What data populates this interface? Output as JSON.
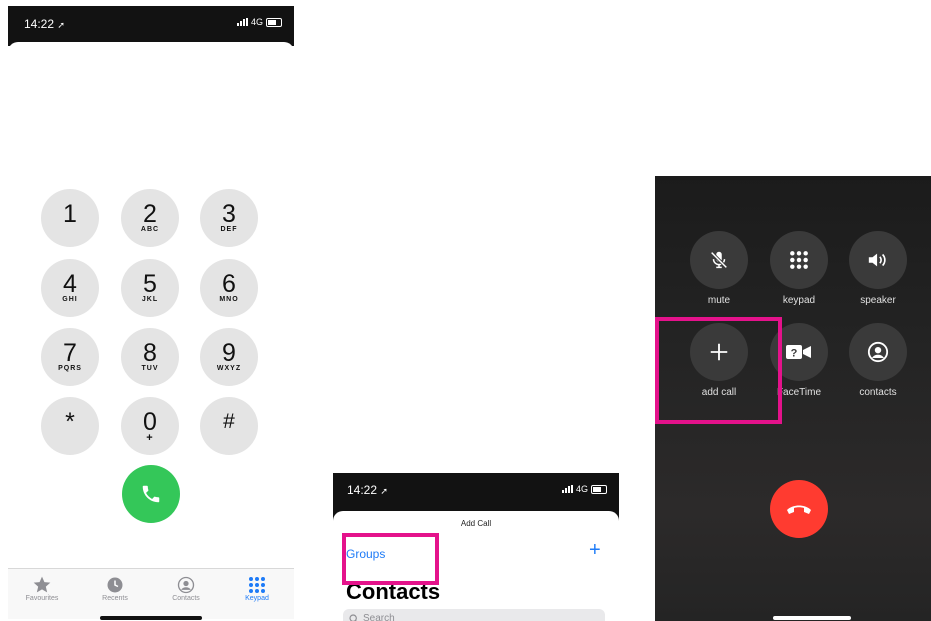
{
  "status": {
    "time": "14:22",
    "network": "4G"
  },
  "keypad": {
    "keys": [
      {
        "digit": "1",
        "letters": ""
      },
      {
        "digit": "2",
        "letters": "ABC"
      },
      {
        "digit": "3",
        "letters": "DEF"
      },
      {
        "digit": "4",
        "letters": "GHI"
      },
      {
        "digit": "5",
        "letters": "JKL"
      },
      {
        "digit": "6",
        "letters": "MNO"
      },
      {
        "digit": "7",
        "letters": "PQRS"
      },
      {
        "digit": "8",
        "letters": "TUV"
      },
      {
        "digit": "9",
        "letters": "WXYZ"
      },
      {
        "digit": "*",
        "letters": ""
      },
      {
        "digit": "0",
        "letters": "+"
      },
      {
        "digit": "#",
        "letters": ""
      }
    ],
    "call_color": "#34c759"
  },
  "tabbar": {
    "tabs": [
      {
        "label": "Favourites",
        "icon": "star-icon",
        "active": false
      },
      {
        "label": "Recents",
        "icon": "clock-icon",
        "active": false
      },
      {
        "label": "Contacts",
        "icon": "person-circle-icon",
        "active": false
      },
      {
        "label": "Keypad",
        "icon": "keypad-grid-icon",
        "active": true
      }
    ],
    "accent": "#1e7bf7"
  },
  "add_call": {
    "title": "Add Call",
    "groups_label": "Groups",
    "add_icon": "plus-icon",
    "contacts_title": "Contacts",
    "search_placeholder": "Search"
  },
  "in_call": {
    "buttons": [
      {
        "label": "mute",
        "icon": "mic-slash-icon"
      },
      {
        "label": "keypad",
        "icon": "keypad-grid-icon"
      },
      {
        "label": "speaker",
        "icon": "speaker-icon"
      },
      {
        "label": "add call",
        "icon": "plus-icon"
      },
      {
        "label": "FaceTime",
        "icon": "facetime-icon"
      },
      {
        "label": "contacts",
        "icon": "person-circle-icon"
      }
    ],
    "end_call_color": "#ff3b30"
  },
  "highlight_color": "#e4128b"
}
